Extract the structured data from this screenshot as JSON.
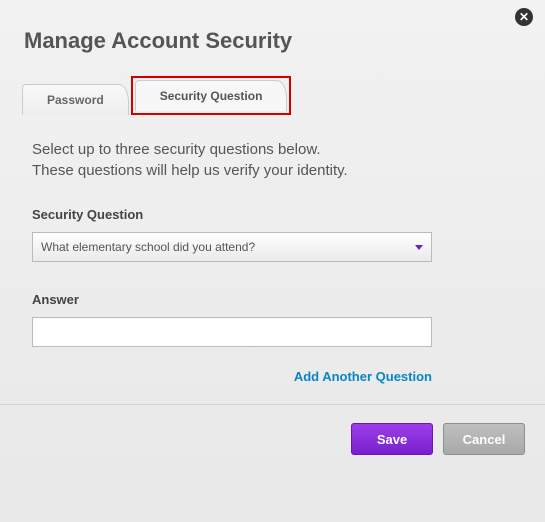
{
  "close_icon": "✕",
  "title": "Manage Account Security",
  "tabs": {
    "password": "Password",
    "security_question": "Security Question"
  },
  "intro_line1": "Select up to three security questions below.",
  "intro_line2": "These questions will help us verify your identity.",
  "labels": {
    "security_question": "Security Question",
    "answer": "Answer"
  },
  "selected_question": "What elementary school did you attend?",
  "answer_value": "",
  "add_link": "Add Another Question",
  "buttons": {
    "save": "Save",
    "cancel": "Cancel"
  }
}
